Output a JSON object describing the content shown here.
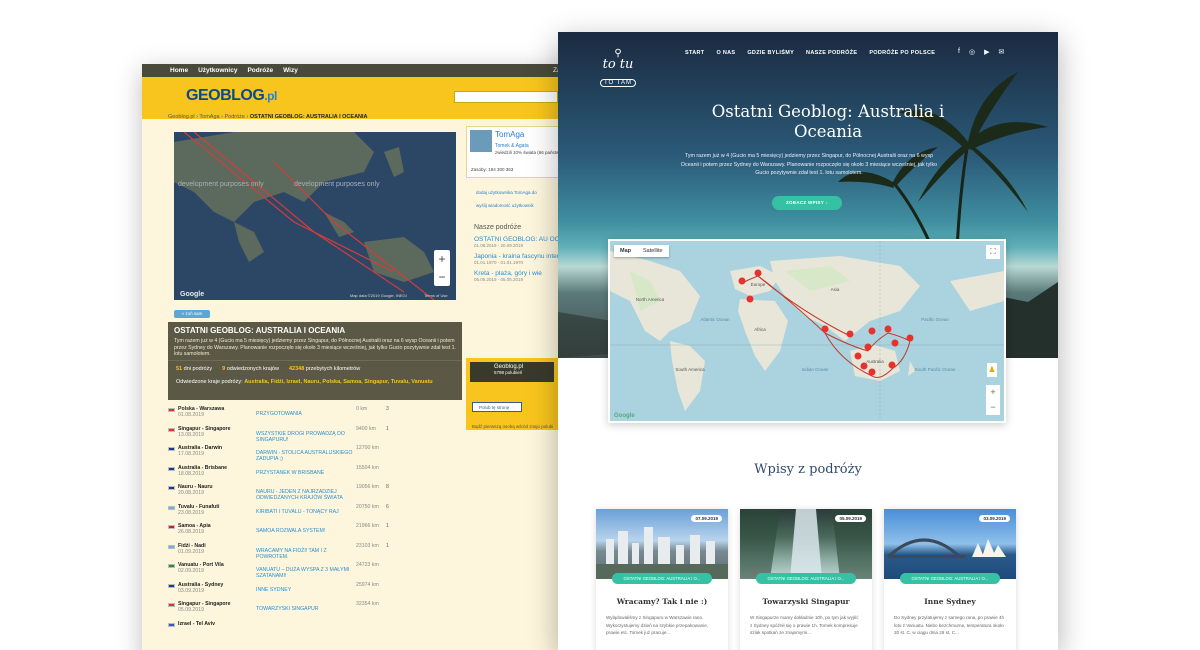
{
  "geoblog": {
    "topnav": [
      "Home",
      "Użytkownicy",
      "Podróże",
      "Wizy"
    ],
    "topnav_right": "Zaloż k",
    "logo": "GEOBLOG",
    "logo_suffix": ".pl",
    "breadcrumb": [
      "Geoblog.pl",
      "TomAga",
      "Podróże",
      "OSTATNI GEOBLOG: AUSTRALIA I OCEANIA"
    ],
    "map_watermark": "development purposes only",
    "map_attribution": "Map data ©2019 Google, INEGI",
    "terms": "Terms of Use",
    "zoom_in": "+",
    "zoom_out": "−",
    "zoom_all_label": "« zoń sam",
    "trip": {
      "title": "OSTATNI GEOBLOG: AUSTRALIA I OCEANIA",
      "description": "Tym razem już w 4 (Gucio ma 5 miesięcy) jedziemy przez Singapur, do Północnej Australii oraz na 6 wysp Oceanii i potem przez Sydney do Warszawy. Planowanie rozpoczęło się około 3 miesiące wcześniej, jak tylko Gucio pozytywnie zdał test 1. lotu samolotem.",
      "entries_count": "51",
      "entries_label": "dni podróży",
      "countries_count": "9",
      "countries_label": "odwiedzonych krajów",
      "km_count": "42348",
      "km_label": "przebytych kilometrów",
      "visited_label": "Odwiedzone kraje podróży:",
      "visited": "Australia, Fidżi, Izrael, Nauru, Polska, Samoa, Singapur, Tuvalu, Vanuatu"
    },
    "rows": [
      {
        "place": "Polska - Warszawa",
        "date": "01.08.2019",
        "entry": "PRZYGOTOWANIA",
        "km": "0 km",
        "cmt": "3",
        "flag": "#d8303a"
      },
      {
        "place": "Singapur - Singapore",
        "date": "13.08.2019",
        "entry": "WSZYSTKIE DROGI PROWADZĄ DO SINGAPURU!",
        "km": "9400 km",
        "cmt": "1",
        "flag": "#e03030"
      },
      {
        "place": "Australia - Darwin",
        "date": "17.08.2019",
        "entry": "Darwin - stolica Australijskiego zadupia ;)",
        "km": "12700 km",
        "cmt": "",
        "flag": "#1b3b8a"
      },
      {
        "place": "Australia - Brisbane",
        "date": "18.08.2019",
        "entry": "Przystanek w Brisbane",
        "km": "15504 km",
        "cmt": "",
        "flag": "#1b3b8a"
      },
      {
        "place": "Nauru - Nauru",
        "date": "20.08.2019",
        "entry": "NAURU - JEDEN Z NAJRZADZIEJ ODWIEDZANYCH KRAJÓW ŚWIATA",
        "km": "19056 km",
        "cmt": "8",
        "flag": "#1a3d8a"
      },
      {
        "place": "Tuvalu - Funafuti",
        "date": "23.08.2019",
        "entry": "KIRIBATI I TUVALU - TONĄCY RAJ",
        "km": "20750 km",
        "cmt": "6",
        "flag": "#6ab0e0"
      },
      {
        "place": "Samoa - Apia",
        "date": "26.08.2019",
        "entry": "SAMOA ROZWALA SYSTEM!",
        "km": "21966 km",
        "cmt": "1",
        "flag": "#c8202a"
      },
      {
        "place": "Fidżi - Nadi",
        "date": "01.09.2019",
        "entry": "Wracamy na Fidżi! Tam i z powrotem.",
        "km": "23103 km",
        "cmt": "1",
        "flag": "#6ab0e0"
      },
      {
        "place": "Vanuatu - Port Vila",
        "date": "02.09.2019",
        "entry": "VANUATU – Duża wyspa z 3 małymi szatanami!",
        "km": "24723 km",
        "cmt": "",
        "flag": "#2a8a3a"
      },
      {
        "place": "Australia - Sydney",
        "date": "03.09.2019",
        "entry": "INNE SYDNEY",
        "km": "25974 km",
        "cmt": "",
        "flag": "#1b3b8a"
      },
      {
        "place": "Singapur - Singapore",
        "date": "05.09.2019",
        "entry": "TOWARZYSKI SINGAPUR",
        "km": "32354 km",
        "cmt": "",
        "flag": "#e03030"
      },
      {
        "place": "Izrael - Tel Aviv",
        "date": "",
        "entry": "",
        "km": "",
        "cmt": "",
        "flag": "#3a5ab8"
      }
    ],
    "side": {
      "user": "TomAga",
      "names": "Tomek & Agata",
      "seen": "zwiedzili 10% świata (66 państw)",
      "mini": "Zasoby:  194   300   363",
      "actions": [
        "dodaj użytkownika TomAga do",
        "wyślij wiadomość użytkownik"
      ],
      "trips_title": "Nasze podróże",
      "trips": [
        {
          "title": "OSTATNI GEOBLOG: AU OCEANIA",
          "dates": "01.08.2019 - 20.09.2019"
        },
        {
          "title": "Japonia - kraina fascynu intensywna",
          "dates": "01.01.1970 - 01.01.1970"
        },
        {
          "title": "Kreta - plaża, góry i wie",
          "dates": "05.05.2019 - 05.05.2019"
        }
      ]
    },
    "fb_page": "Geoblog.pl",
    "fb_count": "5798 polubień",
    "fb_like": "Polub tę stronę",
    "fb_note": "Bądź pierwszą osobą wśród znajo polubi"
  },
  "totutotam": {
    "logo_line1": "to tu",
    "logo_line2": "TO TAM",
    "nav": [
      "START",
      "O NAS",
      "GDZIE BYLIŚMY",
      "NASZE PODRÓŻE",
      "PODRÓŻE PO POLSCE"
    ],
    "social_icons": [
      "facebook-icon",
      "instagram-icon",
      "youtube-icon",
      "mail-icon"
    ],
    "title": "Ostatni Geoblog: Australia i Oceania",
    "lead": "Tym razem już w 4 (Gucio ma 5 miesięcy) jedziemy przez Singapur, do Północnej Australii oraz na 6 wysp Oceanii i potem przez Sydney do Warszawy. Planowanie rozpoczęło się około 3 miesiące wcześniej, jak tylko Gucio pozytywnie zdał test 1. lotu samolotem.",
    "button": "ZOBACZ WPISY ↓",
    "map_tabs": [
      "Map",
      "Satellite"
    ],
    "map_labels": {
      "na": "North America",
      "sa": "South America",
      "af": "Africa",
      "as": "Asia",
      "eu": "Europe",
      "au": "Australia",
      "ao": "Atlantic Ocean",
      "io": "Indian Ocean",
      "po": "Pacific Ocean",
      "so": "South Pacific Ocean"
    },
    "map_google": "Google",
    "section_title": "Wpisy z podróży",
    "cards": [
      {
        "date": "07.09.2019",
        "tag": "OSTATNI GEOBLOG: AUSTRALIA I O...",
        "title": "Wracamy? Tak i nie :)",
        "excerpt": "Wylądowaliśmy z Singapuru w Warszawie rano. Wykorzystujemy dzień na szybkie przepakowanie, prawie etc. Tomek już pracuje..."
      },
      {
        "date": "05.09.2019",
        "tag": "OSTATNI GEOBLOG: AUSTRALIA I O...",
        "title": "Towarzyski Singapur",
        "excerpt": "W Singapurze mamy dokładnie 10h, po tym jak wyjść z Sydney spóźnił się o prawie 1h. Tomek kompresuje szlak spotkań ze znajomymi..."
      },
      {
        "date": "03.09.2019",
        "tag": "OSTATNI GEOBLOG: AUSTRALIA I O...",
        "title": "Inne Sydney",
        "excerpt": "Do Sydney przylatujemy z samego rana, po prawie 4h lotu z Vanuatu. Niebo bezchmurne, temperatura około 20 st. C, w ciągu dnia 26 st. C..."
      }
    ]
  }
}
